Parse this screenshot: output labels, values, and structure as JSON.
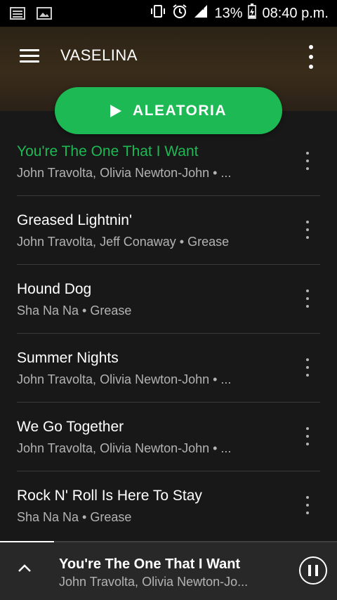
{
  "status_bar": {
    "left_icons": [
      "notification-list-icon",
      "image-icon"
    ],
    "right_icons": [
      "vibrate-icon",
      "alarm-icon",
      "signal-h-icon"
    ],
    "battery": "13%",
    "time": "08:40 p.m."
  },
  "header": {
    "title": "VASELINA"
  },
  "shuffle_button": {
    "label": "ALEATORIA"
  },
  "tracks": [
    {
      "title": "You're The One That I Want",
      "subtitle": "John Travolta, Olivia Newton-John • ...",
      "playing": true
    },
    {
      "title": "Greased Lightnin'",
      "subtitle": "John Travolta, Jeff Conaway • Grease",
      "playing": false
    },
    {
      "title": "Hound Dog",
      "subtitle": "Sha Na Na • Grease",
      "playing": false
    },
    {
      "title": "Summer Nights",
      "subtitle": "John Travolta, Olivia Newton-John • ...",
      "playing": false
    },
    {
      "title": "We Go Together",
      "subtitle": "John Travolta, Olivia Newton-John • ...",
      "playing": false
    },
    {
      "title": "Rock N' Roll Is Here To Stay",
      "subtitle": "Sha Na Na • Grease",
      "playing": false
    }
  ],
  "now_playing": {
    "title": "You're The One That I Want",
    "artist": "John Travolta, Olivia Newton-Jo...",
    "progress": 0.16
  },
  "colors": {
    "accent": "#1db954",
    "background": "#181818",
    "secondary_text": "#b3b3b3"
  }
}
